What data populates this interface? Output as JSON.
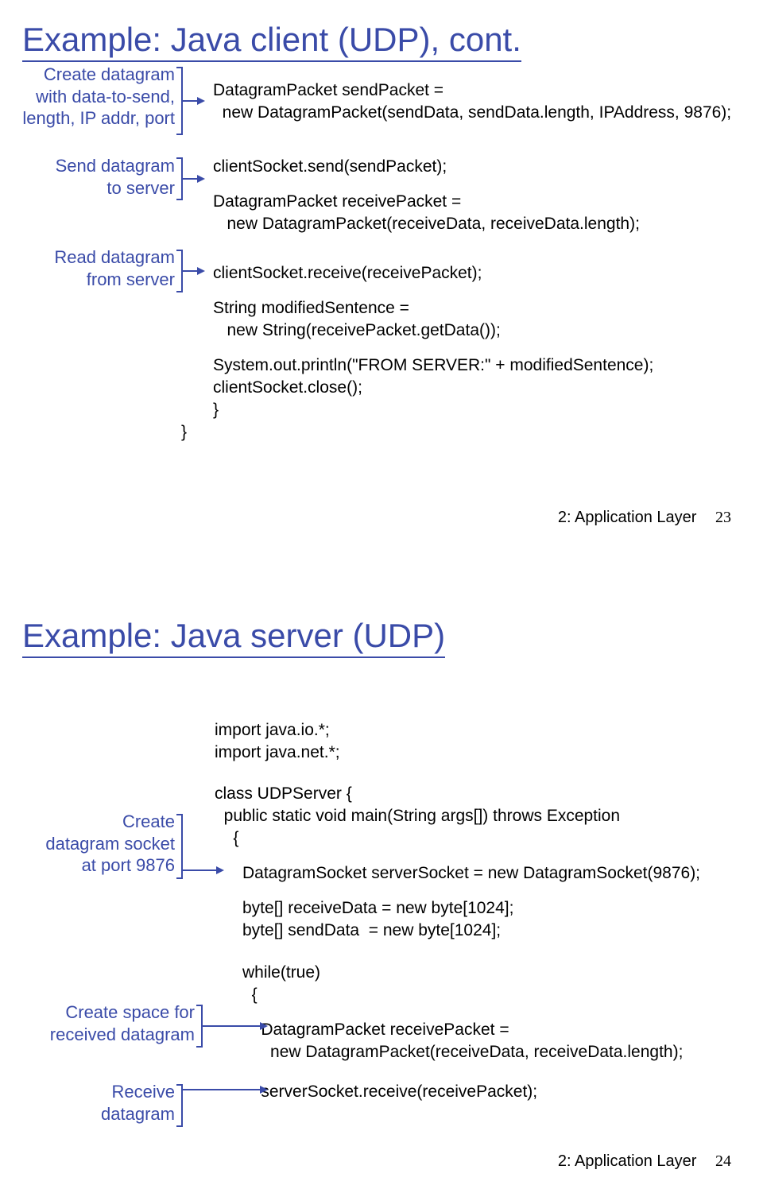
{
  "slide1": {
    "title": "Example: Java client (UDP), cont.",
    "anno": {
      "create_dg": "Create datagram\nwith data-to-send,\nlength, IP addr, port",
      "send_dg": "Send datagram\nto server",
      "read_dg": "Read datagram\nfrom server"
    },
    "code": {
      "l1": "DatagramPacket sendPacket =",
      "l2": "  new DatagramPacket(sendData, sendData.length, IPAddress, 9876);",
      "l3": "clientSocket.send(sendPacket);",
      "l4": "DatagramPacket receivePacket =",
      "l5": "   new DatagramPacket(receiveData, receiveData.length);",
      "l6": "clientSocket.receive(receivePacket);",
      "l7": "String modifiedSentence =",
      "l8": "   new String(receivePacket.getData());",
      "l9": "System.out.println(\"FROM SERVER:\" + modifiedSentence);",
      "l10": "clientSocket.close();",
      "l11": "}",
      "l12": "}"
    },
    "footer": {
      "label": "2: Application Layer",
      "page": "23"
    }
  },
  "slide2": {
    "title": "Example: Java server (UDP)",
    "anno": {
      "create_sock": "Create\ndatagram socket\nat port 9876",
      "create_space": "Create space for\nreceived datagram",
      "receive": "Receive\ndatagram"
    },
    "code": {
      "l1": "import java.io.*;",
      "l2": "import java.net.*;",
      "l3": "class UDPServer {",
      "l4": "  public static void main(String args[]) throws Exception",
      "l5": "    {",
      "l6": "      DatagramSocket serverSocket = new DatagramSocket(9876);",
      "l7": "      byte[] receiveData = new byte[1024];",
      "l8": "      byte[] sendData  = new byte[1024];",
      "l9": "      while(true)",
      "l10": "        {",
      "l11": "          DatagramPacket receivePacket =",
      "l12": "            new DatagramPacket(receiveData, receiveData.length);",
      "l13": "          serverSocket.receive(receivePacket);"
    },
    "footer": {
      "label": "2: Application Layer",
      "page": "24"
    }
  }
}
